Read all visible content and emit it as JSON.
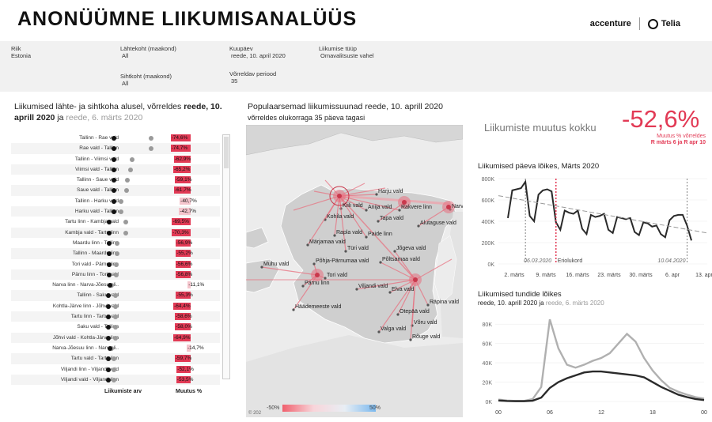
{
  "header": {
    "title": "ANONÜÜMNE LIIKUMISANALÜÜS",
    "logo_accenture": "accenture",
    "logo_telia": "Telia"
  },
  "filters": {
    "riik": {
      "label": "Riik",
      "value": "Estonia"
    },
    "lahtekoht": {
      "label": "Lähtekoht (maakond)",
      "value": "All"
    },
    "sihtkoht": {
      "label": "Sihtkoht (maakond)",
      "value": "All"
    },
    "kuupaev": {
      "label": "Kuupäev",
      "value": "reede, 10. april 2020"
    },
    "vorreldav": {
      "label": "Võrreldav periood",
      "value": "35"
    },
    "tuup": {
      "label": "Liikumise tüüp",
      "value": "Omavalitsuste vahel"
    }
  },
  "left_panel": {
    "title_1": "Liikumised lähte- ja sihtkoha alusel, võrreldes ",
    "title_date": "reede, 10.",
    "title_2": "aprill 2020",
    "title_3": " ja ",
    "title_ref": "reede, 6. märts 2020",
    "footer_count": "Liikumiste arv",
    "footer_change": "Muutus %",
    "rows": [
      {
        "name": "Tallinn - Rae vald",
        "cur": 0.13,
        "ref": 0.8,
        "pct": "-74,6%",
        "val": 74.6
      },
      {
        "name": "Rae vald - Tallinn",
        "cur": 0.13,
        "ref": 0.8,
        "pct": "-74,7%",
        "val": 74.7
      },
      {
        "name": "Tallinn - Viimsi vald",
        "cur": 0.13,
        "ref": 0.45,
        "pct": "-62,9%",
        "val": 62.9
      },
      {
        "name": "Viimsi vald - Tallinn",
        "cur": 0.13,
        "ref": 0.43,
        "pct": "-65,2%",
        "val": 65.2
      },
      {
        "name": "Tallinn - Saue vald",
        "cur": 0.13,
        "ref": 0.37,
        "pct": "-59,1%",
        "val": 59.1
      },
      {
        "name": "Saue vald - Tallinn",
        "cur": 0.13,
        "ref": 0.35,
        "pct": "-61,7%",
        "val": 61.7
      },
      {
        "name": "Tallinn - Harku vald",
        "cur": 0.13,
        "ref": 0.25,
        "pct": "-40,7%",
        "val": 40.7
      },
      {
        "name": "Harku vald - Tallinn",
        "cur": 0.13,
        "ref": 0.25,
        "pct": "-42,7%",
        "val": 42.7
      },
      {
        "name": "Tartu linn - Kambja vald",
        "cur": 0.04,
        "ref": 0.34,
        "pct": "-69,5%",
        "val": 69.5
      },
      {
        "name": "Kambja vald - Tartu linn",
        "cur": 0.04,
        "ref": 0.34,
        "pct": "-70,3%",
        "val": 70.3
      },
      {
        "name": "Maardu linn - Tallinn",
        "cur": 0.04,
        "ref": 0.19,
        "pct": "-56,9%",
        "val": 56.9
      },
      {
        "name": "Tallinn - Maardu linn",
        "cur": 0.04,
        "ref": 0.19,
        "pct": "-55,2%",
        "val": 55.2
      },
      {
        "name": "Tori vald - Pärnu linn",
        "cur": 0.04,
        "ref": 0.17,
        "pct": "-56,6%",
        "val": 56.6
      },
      {
        "name": "Pärnu linn - Tori vald",
        "cur": 0.04,
        "ref": 0.17,
        "pct": "-56,8%",
        "val": 56.8
      },
      {
        "name": "Narva linn - Narva-Jõesuu li..",
        "cur": 0.06,
        "ref": 0.08,
        "pct": "-11,1%",
        "val": 11.1
      },
      {
        "name": "Tallinn - Saku vald",
        "cur": 0.03,
        "ref": 0.16,
        "pct": "-55,3%",
        "val": 55.3
      },
      {
        "name": "Kohtla-Järve linn - Jõhvi vald",
        "cur": 0.03,
        "ref": 0.16,
        "pct": "-64,4%",
        "val": 64.4
      },
      {
        "name": "Tartu linn - Tartu vald",
        "cur": 0.03,
        "ref": 0.15,
        "pct": "-58,6%",
        "val": 58.6
      },
      {
        "name": "Saku vald - Tallinn",
        "cur": 0.03,
        "ref": 0.15,
        "pct": "-58,0%",
        "val": 58.0
      },
      {
        "name": "Jõhvi vald - Kohtla-Järve linn",
        "cur": 0.03,
        "ref": 0.15,
        "pct": "-64,9%",
        "val": 64.9
      },
      {
        "name": "Narva-Jõesuu linn - Narva li..",
        "cur": 0.06,
        "ref": 0.08,
        "pct": "-14,7%",
        "val": 14.7
      },
      {
        "name": "Tartu vald - Tartu linn",
        "cur": 0.03,
        "ref": 0.13,
        "pct": "-59,7%",
        "val": 59.7
      },
      {
        "name": "Viljandi linn - Viljandi vald",
        "cur": 0.03,
        "ref": 0.13,
        "pct": "-52,1%",
        "val": 52.1
      },
      {
        "name": "Viljandi vald - Viljandi linn",
        "cur": 0.03,
        "ref": 0.13,
        "pct": "-53,5%",
        "val": 53.5
      }
    ]
  },
  "map_panel": {
    "title_1": "Populaarsemad liikumissuunad ",
    "title_date": "reede, 10. aprill 2020",
    "subtitle": "võrreldes olukorraga 35 päeva tagasi",
    "legend_min": "-50%",
    "legend_max": "50%",
    "copyright": "© 202",
    "places": [
      {
        "name": "Harju vald"
      },
      {
        "name": "Kiili vald"
      },
      {
        "name": "Anija vald"
      },
      {
        "name": "Tapa vald"
      },
      {
        "name": "Rakvere linn"
      },
      {
        "name": "Narva-Jõesuu"
      },
      {
        "name": "Kohila vald"
      },
      {
        "name": "Alutaguse vald"
      },
      {
        "name": "Rapla vald"
      },
      {
        "name": "Paide linn"
      },
      {
        "name": "Märjamaa vald"
      },
      {
        "name": "Türi vald"
      },
      {
        "name": "Jõgeva vald"
      },
      {
        "name": "Põhja-Pärnumaa vald"
      },
      {
        "name": "Põltsamaa vald"
      },
      {
        "name": "Muhu vald"
      },
      {
        "name": "Tori vald"
      },
      {
        "name": "Pärnu linn"
      },
      {
        "name": "Viljandi vald"
      },
      {
        "name": "Elva vald"
      },
      {
        "name": "Räpina vald"
      },
      {
        "name": "Häädemeeste vald"
      },
      {
        "name": "Otepää vald"
      },
      {
        "name": "Võru vald"
      },
      {
        "name": "Valga vald"
      },
      {
        "name": "Rõuge vald"
      }
    ]
  },
  "kpi": {
    "label": "Liikumiste muutus kokku",
    "value": "-52,6%",
    "sub_1": "Muutus % võrreldes",
    "sub_2": "R märts 6 ja R apr 10"
  },
  "daily_chart": {
    "title": "Liikumised päeva lõikes, Märts 2020",
    "y_ticks": [
      "800K",
      "600K",
      "400K",
      "200K",
      "0K"
    ],
    "x_ticks": [
      "2. märts",
      "9. märts",
      "16. märts",
      "23. märts",
      "30. märts",
      "6. apr",
      "13. apr"
    ],
    "annot_left": "06.03.2020",
    "annot_mid": "Eriolukord",
    "annot_right": "10.04.2020"
  },
  "hourly_chart": {
    "title": "Liikumised tundide lõikes",
    "sub_date": "reede, 10. aprill 2020",
    "sub_ja": " ja ",
    "sub_ref": "reede, 6. märts 2020",
    "y_ticks": [
      "80K",
      "60K",
      "40K",
      "20K",
      "0K"
    ],
    "x_ticks": [
      "00",
      "06",
      "12",
      "18",
      "00"
    ]
  },
  "chart_data": [
    {
      "type": "line",
      "title": "Liikumised päeva lõikes, Märts 2020",
      "ylim": [
        0,
        800000
      ],
      "series": [
        {
          "values": [
            430000,
            690000,
            700000,
            710000,
            770000,
            450000,
            400000,
            650000,
            690000,
            700000,
            680000,
            390000,
            320000,
            500000,
            480000,
            470000,
            500000,
            330000,
            280000,
            460000,
            440000,
            450000,
            470000,
            320000,
            290000,
            440000,
            430000,
            420000,
            430000,
            300000,
            270000,
            390000,
            380000,
            350000,
            360000,
            280000,
            250000,
            410000,
            450000,
            460000,
            460000,
            360000,
            220000
          ]
        }
      ]
    },
    {
      "type": "line",
      "title": "Liikumised tundide lõikes",
      "ylim": [
        0,
        90000
      ],
      "categories": [
        "00",
        "01",
        "02",
        "03",
        "04",
        "05",
        "06",
        "07",
        "08",
        "09",
        "10",
        "11",
        "12",
        "13",
        "14",
        "15",
        "16",
        "17",
        "18",
        "19",
        "20",
        "21",
        "22",
        "23",
        "24"
      ],
      "series": [
        {
          "name": "reede, 10. aprill 2020",
          "values": [
            1000,
            500,
            300,
            300,
            800,
            4000,
            14000,
            20000,
            24000,
            27000,
            30000,
            31000,
            31000,
            30000,
            29000,
            28000,
            27000,
            25000,
            20000,
            15000,
            11000,
            7000,
            4500,
            2500,
            1500
          ]
        },
        {
          "name": "reede, 6. märts 2020",
          "values": [
            2000,
            1000,
            600,
            600,
            2500,
            15000,
            85000,
            55000,
            38000,
            35000,
            38000,
            42000,
            45000,
            50000,
            60000,
            70000,
            62000,
            45000,
            32000,
            22000,
            14000,
            10000,
            7000,
            4500,
            3000
          ]
        }
      ]
    }
  ]
}
